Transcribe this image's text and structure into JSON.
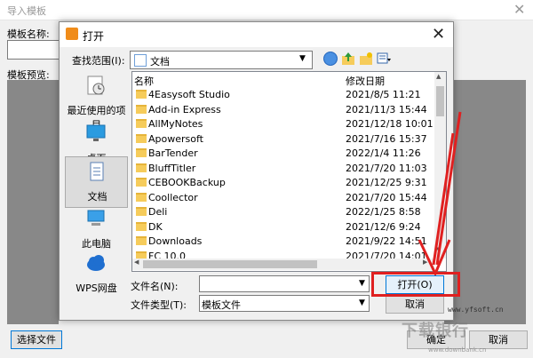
{
  "background_window": {
    "title": "导入模板",
    "template_name_label": "模板名称:",
    "preview_label": "模板预览:",
    "choose_file_button": "选择文件",
    "ok_button": "确定",
    "cancel_button": "取消"
  },
  "dialog": {
    "title": "打开",
    "look_in_label": "查找范围(I):",
    "look_in_value": "文档",
    "places": [
      {
        "label": "最近使用的项目",
        "icon": "recent-icon"
      },
      {
        "label": "桌面",
        "icon": "desktop-icon"
      },
      {
        "label": "文档",
        "icon": "documents-icon",
        "selected": true
      },
      {
        "label": "此电脑",
        "icon": "computer-icon"
      },
      {
        "label": "WPS网盘",
        "icon": "cloud-icon"
      }
    ],
    "columns": {
      "name": "名称",
      "date": "修改日期"
    },
    "files": [
      {
        "name": "4Easysoft Studio",
        "date": "2021/8/5 11:21"
      },
      {
        "name": "Add-in Express",
        "date": "2021/11/3 15:44"
      },
      {
        "name": "AllMyNotes",
        "date": "2021/12/18 10:01"
      },
      {
        "name": "Apowersoft",
        "date": "2021/7/16 15:37"
      },
      {
        "name": "BarTender",
        "date": "2022/1/4 11:26"
      },
      {
        "name": "BluffTitler",
        "date": "2021/7/20 11:03"
      },
      {
        "name": "CEBOOKBackup",
        "date": "2021/12/25 9:31"
      },
      {
        "name": "Coollector",
        "date": "2021/7/20 15:44"
      },
      {
        "name": "Deli",
        "date": "2022/1/25 8:58"
      },
      {
        "name": "DK",
        "date": "2021/12/6 9:24"
      },
      {
        "name": "Downloads",
        "date": "2021/9/22 14:51"
      },
      {
        "name": "FC 10.0",
        "date": "2021/7/20 14:01"
      }
    ],
    "filename_label": "文件名(N):",
    "filename_value": "",
    "filetype_label": "文件类型(T):",
    "filetype_value": "模板文件",
    "open_button": "打开(O)",
    "cancel_button": "取消"
  },
  "watermark": {
    "url": "www.yfsoft.cn",
    "logo": "下载银行",
    "sub": "www.downbank.cn"
  },
  "colors": {
    "annotation_red": "#e02020",
    "folder_yellow": "#f6cc5b",
    "accent_blue": "#0078d7"
  }
}
